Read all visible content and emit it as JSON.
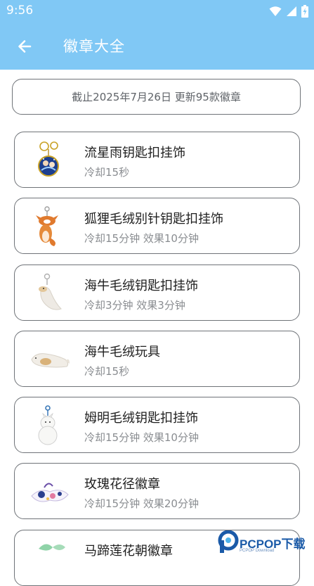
{
  "status": {
    "time": "9:56"
  },
  "header": {
    "title": "徽章大全"
  },
  "notice": "截止2025年7月26日 更新95款徽章",
  "items": [
    {
      "name": "流星雨钥匙扣挂饰",
      "detail": "冷却15秒"
    },
    {
      "name": "狐狸毛绒别针钥匙扣挂饰",
      "detail": "冷却15分钟 效果10分钟"
    },
    {
      "name": "海牛毛绒钥匙扣挂饰",
      "detail": "冷却3分钟 效果3分钟"
    },
    {
      "name": "海牛毛绒玩具",
      "detail": "冷却15秒"
    },
    {
      "name": "姆明毛绒钥匙扣挂饰",
      "detail": "冷却15分钟 效果10分钟"
    },
    {
      "name": "玫瑰花径徽章",
      "detail": "冷却15分钟 效果20分钟"
    },
    {
      "name": "马蹄莲花朝徽章",
      "detail": ""
    }
  ],
  "watermark": {
    "text": "PCPOP下载",
    "sub": "PCPOP Download"
  },
  "colors": {
    "appbar": "#80c8f5",
    "border": "#6f7378",
    "subtext": "#8a8d91"
  }
}
